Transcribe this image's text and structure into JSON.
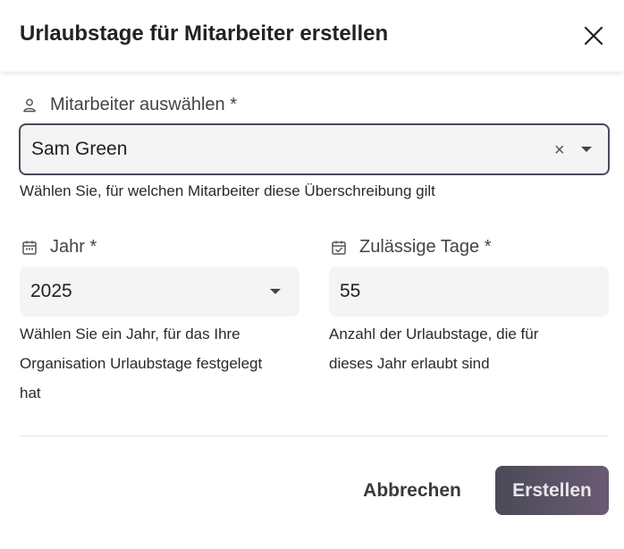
{
  "dialog": {
    "title": "Urlaubstage für Mitarbeiter erstellen"
  },
  "employee": {
    "label": "Mitarbeiter auswählen *",
    "icon": "person-icon",
    "value": "Sam Green",
    "clear_symbol": "×",
    "helper": "Wählen Sie, für welchen Mitarbeiter diese Überschreibung gilt"
  },
  "year": {
    "label": "Jahr *",
    "icon": "calendar-icon",
    "value": "2025",
    "helper_lines": [
      "Wählen Sie ein Jahr, für das Ihre",
      "Organisation Urlaubstage festgelegt",
      "hat"
    ]
  },
  "days": {
    "label": "Zulässige Tage *",
    "icon": "calendar-check-icon",
    "value": "55",
    "helper_lines": [
      "Anzahl der Urlaubstage, die für",
      "dieses Jahr erlaubt sind"
    ]
  },
  "actions": {
    "cancel_label": "Abbrechen",
    "create_label": "Erstellen"
  },
  "colors": {
    "accent_start": "#4a4a57",
    "accent_end": "#6a5b73",
    "field_bg": "#f4f4f4"
  }
}
